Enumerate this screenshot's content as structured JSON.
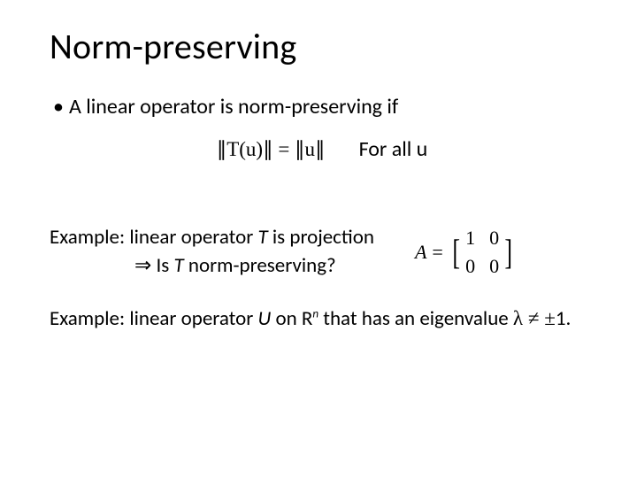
{
  "title": "Norm-preserving",
  "bullet1": "A linear operator is norm-preserving if",
  "equation": "∥T(u)∥ = ∥u∥",
  "for_all": "For all u",
  "example1": {
    "line1_prefix": "Example: linear operator ",
    "line1_var": "T",
    "line1_suffix": " is projection",
    "line2_arrow": "⇒",
    "line2_prefix": " Is ",
    "line2_var": "T",
    "line2_suffix": " norm-preserving?"
  },
  "matrix": {
    "label": "A",
    "eq": "=",
    "m11": "1",
    "m12": "0",
    "m21": "0",
    "m22": "0"
  },
  "example2": {
    "prefix": "Example: linear operator ",
    "U": "U",
    "mid": " on R",
    "sup": "n",
    "mid2": " that has an eigenvalue ",
    "lambda": "λ",
    "neq": " ≠ ",
    "pm": "±",
    "one": "1."
  }
}
